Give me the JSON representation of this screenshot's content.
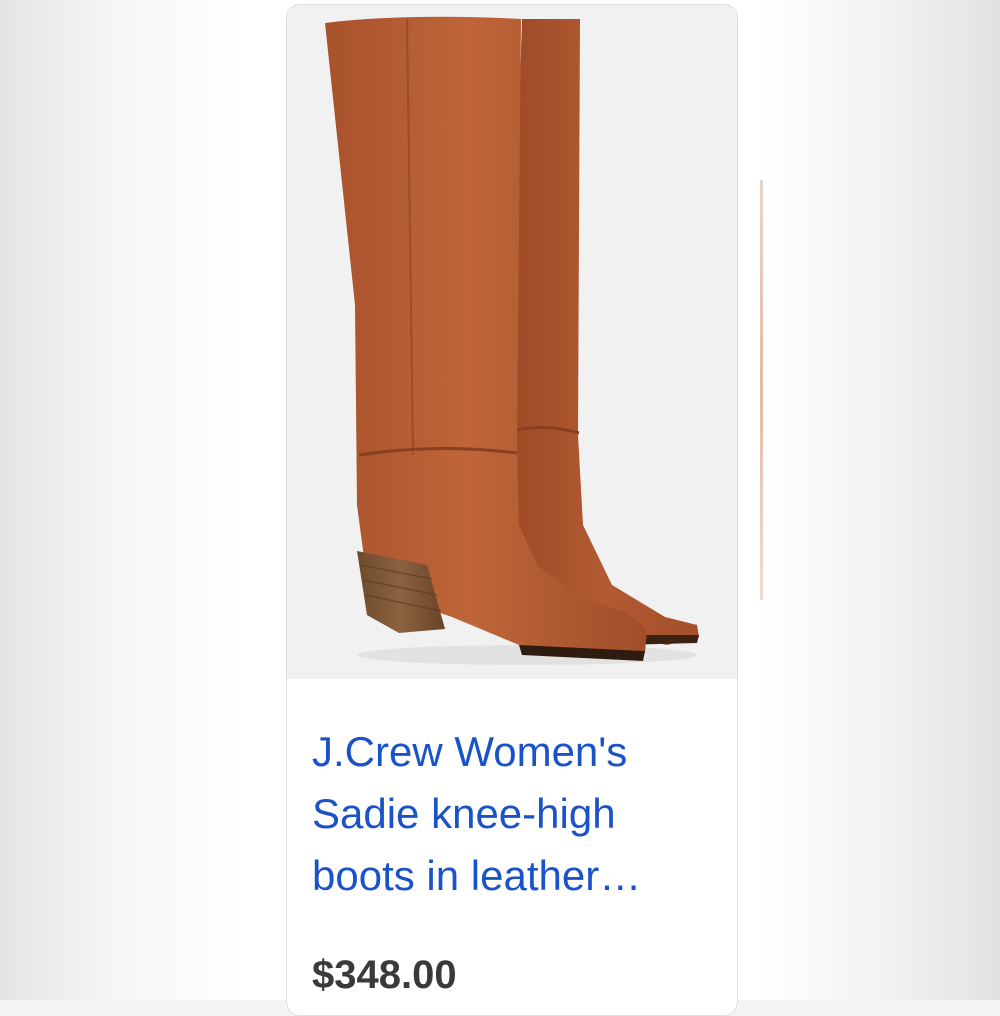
{
  "listing": {
    "image_alt": "Cognac leather knee-high boots with stacked wood heel",
    "title_lines": [
      "J.Crew Women's",
      "Sadie knee-high",
      "boots in leather…"
    ],
    "price": "$348.00"
  },
  "colors": {
    "title_link": "#1a53c8",
    "price_text": "#3a3a3a",
    "boot_leather": "#b55a32"
  }
}
